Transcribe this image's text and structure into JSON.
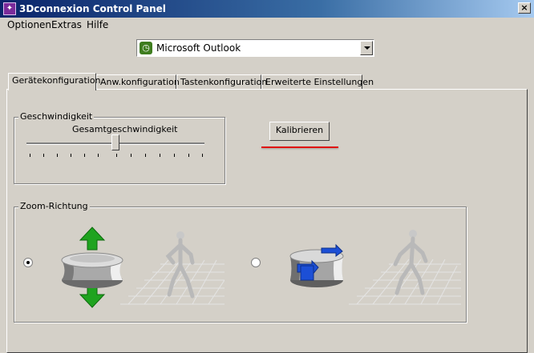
{
  "window": {
    "title": "3Dconnexion Control Panel",
    "close_symbol": "×",
    "app_icon": "3dconnexion-app-icon"
  },
  "menu": {
    "items": [
      "Optionen",
      "Extras",
      "Hilfe"
    ]
  },
  "app_selector": {
    "selected": "Microsoft Outlook",
    "icon": "outlook-clock-icon"
  },
  "tabs": [
    {
      "label": "Gerätekonfiguration",
      "active": true
    },
    {
      "label": "Anw.konfiguration",
      "active": false
    },
    {
      "label": "Tastenkonfiguration",
      "active": false
    },
    {
      "label": "Erweiterte Einstellungen",
      "active": false
    }
  ],
  "speed_group": {
    "title": "Geschwindigkeit",
    "slider_label": "Gesamtgeschwindigkeit",
    "slider_value_fraction": 0.5
  },
  "calibrate_button": "Kalibrieren",
  "zoom_group": {
    "title": "Zoom-Richtung",
    "options": [
      {
        "name": "zoom-up-down",
        "checked": true
      },
      {
        "name": "zoom-push-pull",
        "checked": false
      }
    ]
  },
  "colors": {
    "titlebar": "#0a246a",
    "window_bg": "#d4d0c8",
    "annotation_red": "#e01010",
    "arrow_green": "#1fa31f",
    "cap_blue": "#1c4fd6"
  }
}
